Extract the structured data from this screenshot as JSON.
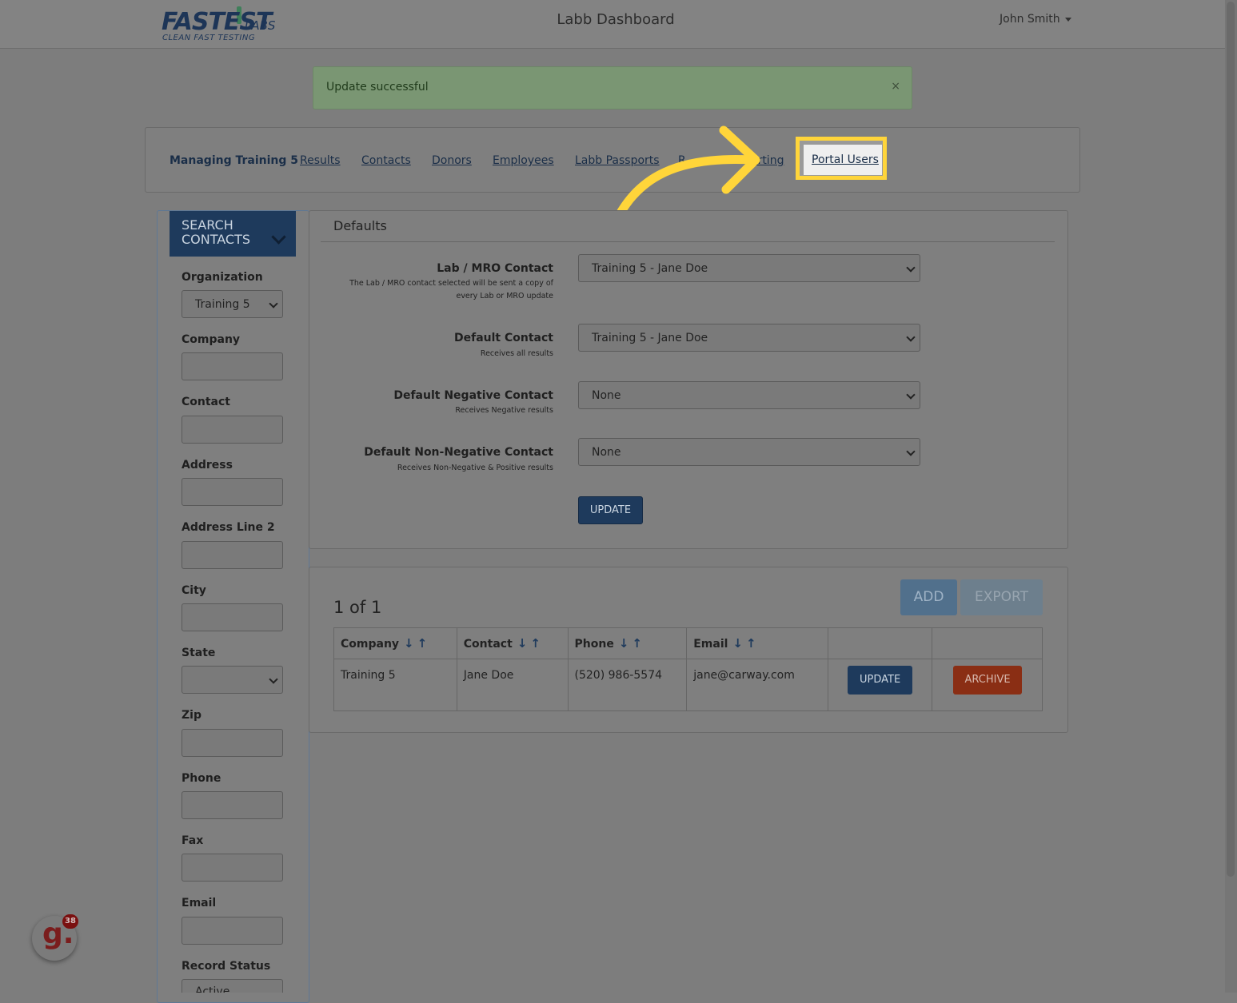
{
  "header": {
    "logo_brand": "FASTEST",
    "logo_suffix": "LABS",
    "logo_tagline": "CLEAN FAST TESTING",
    "title": "Labb Dashboard",
    "user_name": "John Smith"
  },
  "alert": {
    "message": "Update successful",
    "close_label": "×"
  },
  "nav": {
    "brand": "Managing Training 5",
    "items": [
      "Results",
      "Contacts",
      "Donors",
      "Employees",
      "Labb Passports",
      "R",
      "orting",
      "Portal Users"
    ],
    "highlighted_item": "Portal Users"
  },
  "sidebar": {
    "header": "SEARCH CONTACTS",
    "header_line1": "SEARCH",
    "header_line2": "CONTACTS",
    "fields": {
      "organization_label": "Organization",
      "organization_value": "Training 5",
      "company_label": "Company",
      "contact_label": "Contact",
      "address_label": "Address",
      "address2_label": "Address Line 2",
      "city_label": "City",
      "state_label": "State",
      "zip_label": "Zip",
      "phone_label": "Phone",
      "fax_label": "Fax",
      "email_label": "Email",
      "record_status_label": "Record Status",
      "record_status_value": "Active"
    }
  },
  "defaults": {
    "title": "Defaults",
    "lab_mro_label": "Lab / MRO Contact",
    "lab_mro_help_1": "The Lab / MRO contact selected will be sent a copy of",
    "lab_mro_help_2": "every Lab or MRO update",
    "lab_mro_value": "Training 5 - Jane Doe",
    "default_contact_label": "Default Contact",
    "default_contact_help": "Receives all results",
    "default_contact_value": "Training 5 - Jane Doe",
    "negative_label": "Default Negative Contact",
    "negative_help": "Receives Negative results",
    "negative_value": "None",
    "non_negative_label": "Default Non-Negative Contact",
    "non_negative_help": "Receives Non-Negative & Positive results",
    "non_negative_value": "None",
    "update_label": "UPDATE"
  },
  "contacts": {
    "count_text": "1 of 1",
    "add_label": "ADD",
    "export_label": "EXPORT",
    "columns": [
      "Company",
      "Contact",
      "Phone",
      "Email"
    ],
    "rows": [
      {
        "company": "Training 5",
        "contact": "Jane Doe",
        "phone": "(520) 986-5574",
        "email": "jane@carway.com",
        "update_label": "UPDATE",
        "archive_label": "ARCHIVE"
      }
    ]
  },
  "widget": {
    "glyph": "g.",
    "badge_count": "38"
  },
  "colors": {
    "primary": "#1e3a5c",
    "danger": "#8a2e14",
    "highlight": "#ffd53a",
    "alert_success": "#7a9673"
  }
}
